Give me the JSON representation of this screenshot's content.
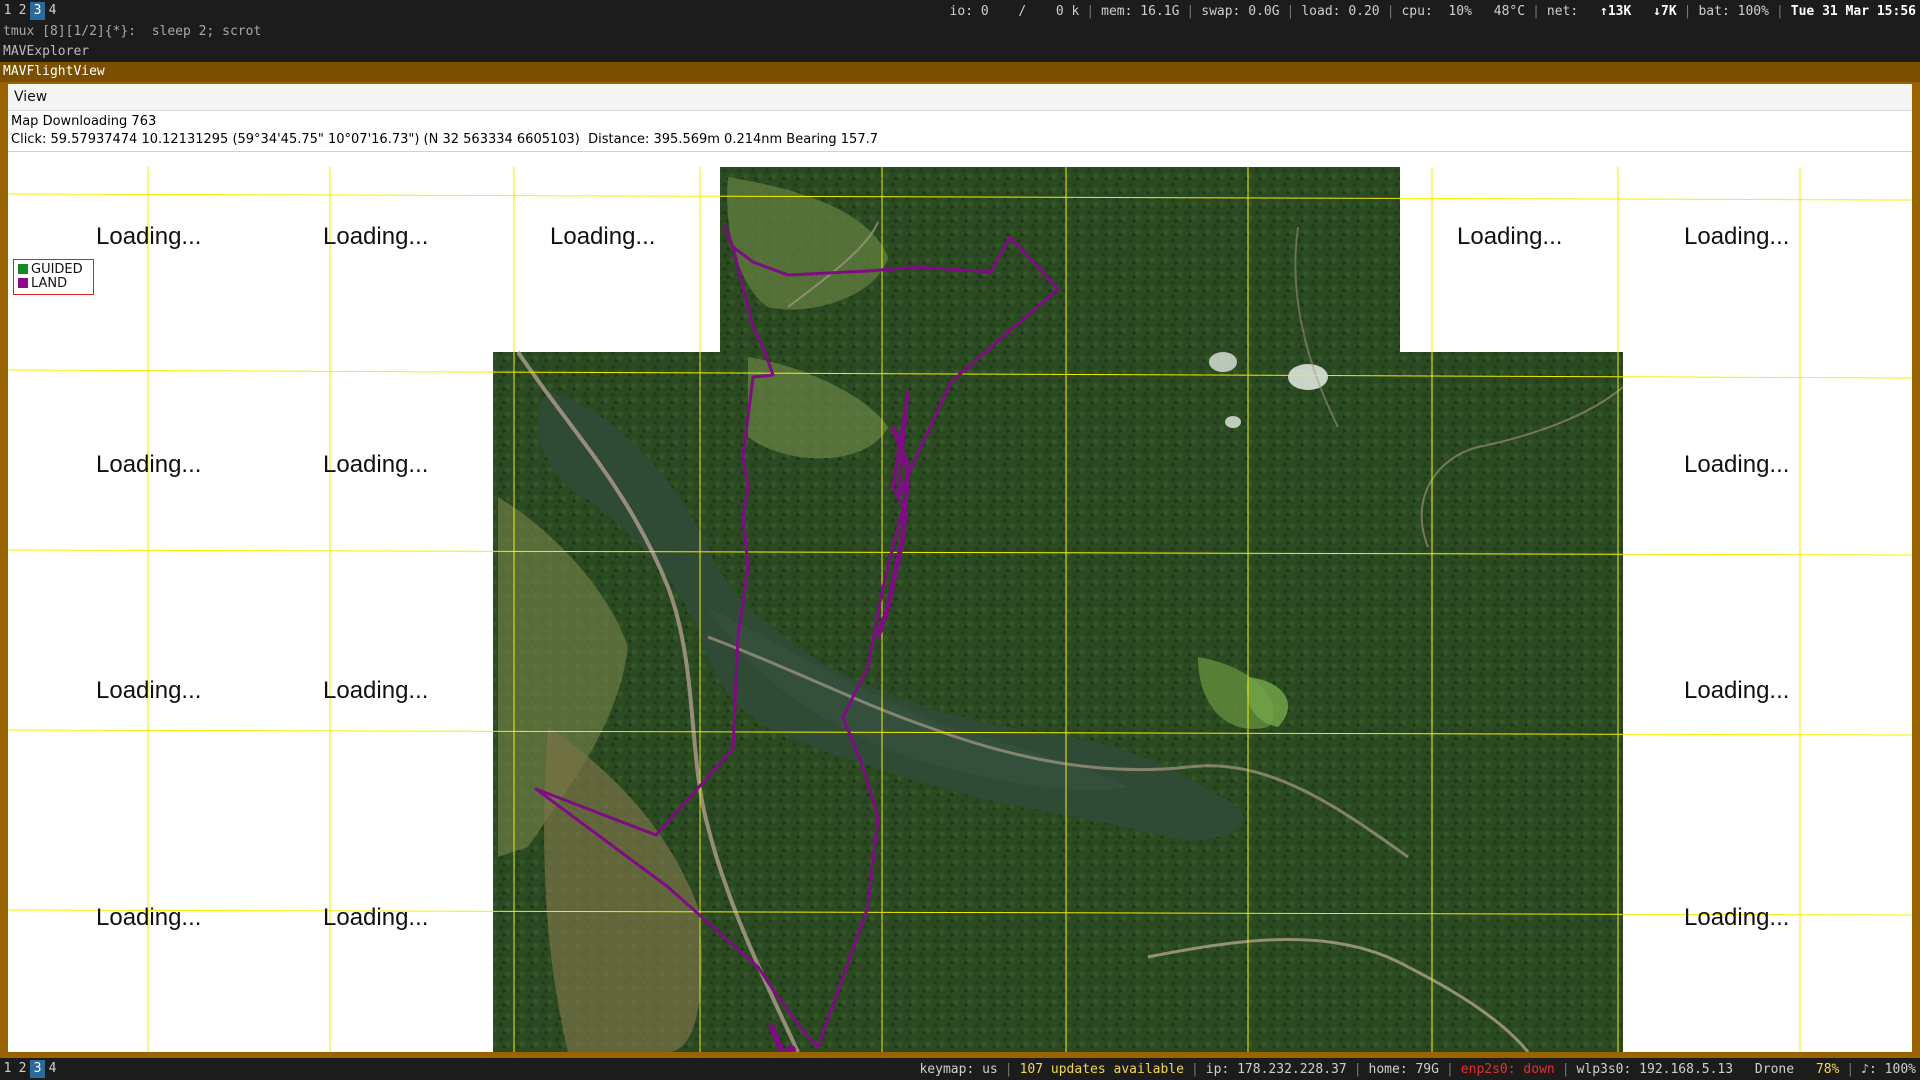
{
  "top_bar": {
    "workspaces": [
      "1",
      "2",
      "3",
      "4"
    ],
    "active_workspace": "3",
    "io": "io: 0",
    "io_sep": "/",
    "io_rate": "0 k",
    "mem": "mem: 16.1G",
    "swap": "swap: 0.0G",
    "load": "load: 0.20",
    "cpu": "cpu:  10%",
    "temp": "48°C",
    "net_label": "net:",
    "net_up": "↑13K",
    "net_down": "↓7K",
    "bat": "bat: 100%",
    "datetime": "Tue 31 Mar 15:56"
  },
  "terminal_line": "tmux [8][1/2]{*}:  sleep 2; scrot",
  "window_titles": {
    "explorer": "MAVExplorer",
    "flightview": "MAVFlightView"
  },
  "menu": {
    "view_label": "View"
  },
  "info": {
    "line1": "Map Downloading 763",
    "line2": "Click: 59.57937474 10.12131295 (59°34'45.75\" 10°07'16.73\") (N 32 563334 6605103)  Distance: 395.569m 0.214nm Bearing 157.7"
  },
  "legend": {
    "items": [
      {
        "label": "GUIDED",
        "color": "#138a26"
      },
      {
        "label": "LAND",
        "color": "#8a0a8a"
      }
    ]
  },
  "map": {
    "loading_text": "Loading...",
    "route_color": "#7f0c84",
    "grid_color": "#f2f000"
  },
  "bottom_bar": {
    "workspaces": [
      "1",
      "2",
      "3",
      "4"
    ],
    "active_workspace": "3",
    "keymap": "keymap: us",
    "updates": "107 updates available",
    "ip": "ip: 178.232.228.37",
    "home": "home: 79G",
    "enp": "enp2s0: down",
    "wlp": "wlp3s0: 192.168.5.13",
    "ssid": "Drone",
    "wifi_strength": "78%",
    "volume": "♪: 100%"
  }
}
